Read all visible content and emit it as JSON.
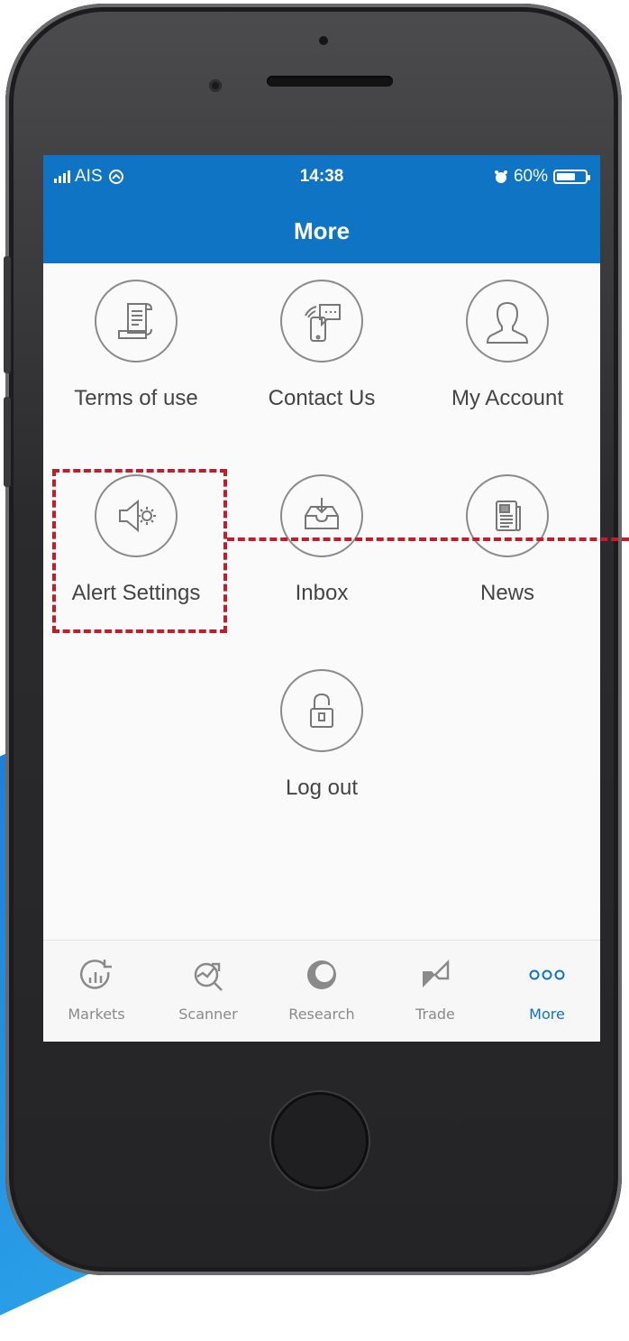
{
  "status_bar": {
    "carrier": "AIS",
    "time": "14:38",
    "battery_percent": "60%",
    "battery_level": 0.6
  },
  "nav": {
    "title": "More"
  },
  "menu": {
    "items": [
      {
        "label": "Terms of use",
        "icon": "document-icon"
      },
      {
        "label": "Contact Us",
        "icon": "phone-chat-icon"
      },
      {
        "label": "My Account",
        "icon": "user-icon"
      },
      {
        "label": "Alert Settings",
        "icon": "alert-settings-icon"
      },
      {
        "label": "Inbox",
        "icon": "inbox-icon"
      },
      {
        "label": "News",
        "icon": "newspaper-icon"
      },
      {
        "label": "Log out",
        "icon": "lock-icon"
      }
    ]
  },
  "tabbar": {
    "tabs": [
      {
        "label": "Markets",
        "icon": "markets-icon",
        "active": false
      },
      {
        "label": "Scanner",
        "icon": "scanner-icon",
        "active": false
      },
      {
        "label": "Research",
        "icon": "research-icon",
        "active": false
      },
      {
        "label": "Trade",
        "icon": "trade-icon",
        "active": false
      },
      {
        "label": "More",
        "icon": "more-icon",
        "active": true
      }
    ]
  },
  "colors": {
    "brand_blue": "#0f74c3",
    "highlight_red": "#c21d2a",
    "icon_gray": "#8a8a8a",
    "active_tab": "#0f74c3"
  }
}
